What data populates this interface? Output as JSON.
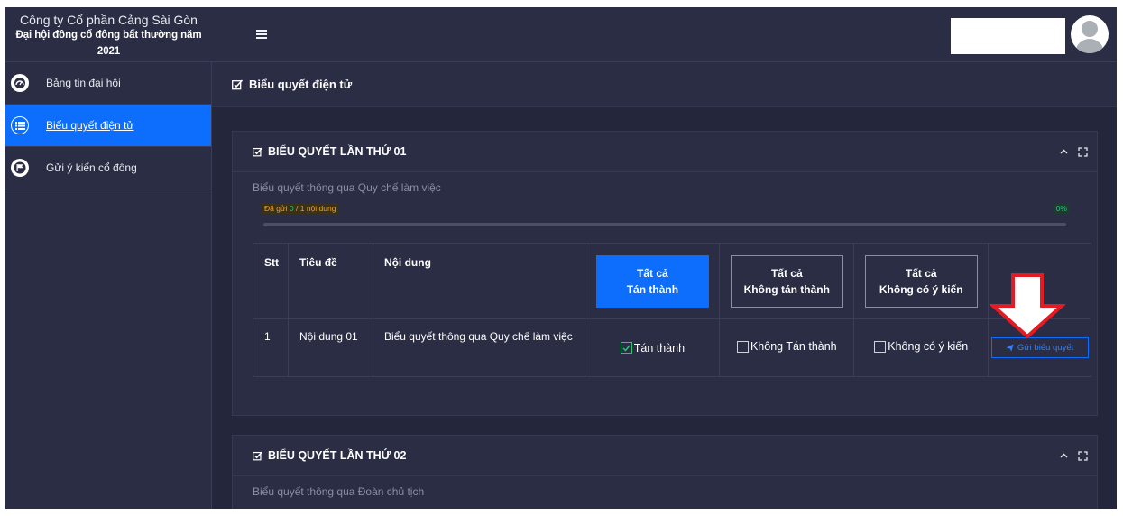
{
  "header": {
    "company": "Công ty Cổ phần Cảng Sài Gòn",
    "event": "Đại hội đồng cổ đông bất thường năm 2021"
  },
  "sidebar": {
    "items": [
      {
        "label": "Bảng tin đại hội",
        "icon": "dashboard-icon",
        "active": false
      },
      {
        "label": "Biểu quyết điện tử",
        "icon": "list-icon",
        "active": true
      },
      {
        "label": "Gửi ý kiến cổ đông",
        "icon": "flag-icon",
        "active": false
      }
    ]
  },
  "page": {
    "title": "Biểu quyết điện tử"
  },
  "vote1": {
    "title": "BIỂU QUYẾT LẦN THỨ 01",
    "subtitle": "Biểu quyết thông qua Quy chế làm việc",
    "sent_prefix": "Đã gửi ",
    "sent_count": "0",
    "sent_suffix": " / 1 nội dung",
    "percent": "0%",
    "progress": 0,
    "table": {
      "headers": {
        "stt": "Stt",
        "title": "Tiêu đề",
        "content": "Nội dung"
      },
      "all_approve": {
        "line1": "Tất cả",
        "line2": "Tán thành"
      },
      "all_disapprove": {
        "line1": "Tất cả",
        "line2": "Không tán thành"
      },
      "all_no_opinion": {
        "line1": "Tất cả",
        "line2": "Không có ý kiến"
      },
      "rows": [
        {
          "stt": "1",
          "title": "Nội dung 01",
          "content": "Biểu quyết thông qua Quy chế làm việc",
          "opt_approve": "Tán thành",
          "opt_disapprove": "Không Tán thành",
          "opt_no_opinion": "Không có ý kiến",
          "approve_checked": true,
          "send_label": "Gửi biểu quyết"
        }
      ]
    }
  },
  "vote2": {
    "title": "BIỂU QUYẾT LẦN THỨ 02",
    "subtitle": "Biểu quyết thông qua Đoàn chủ tịch"
  },
  "colors": {
    "background": "#2a2d43",
    "accent": "#0d6efd",
    "success": "#28c76f",
    "warning": "#f0a12c",
    "arrow": "#e51b24"
  }
}
